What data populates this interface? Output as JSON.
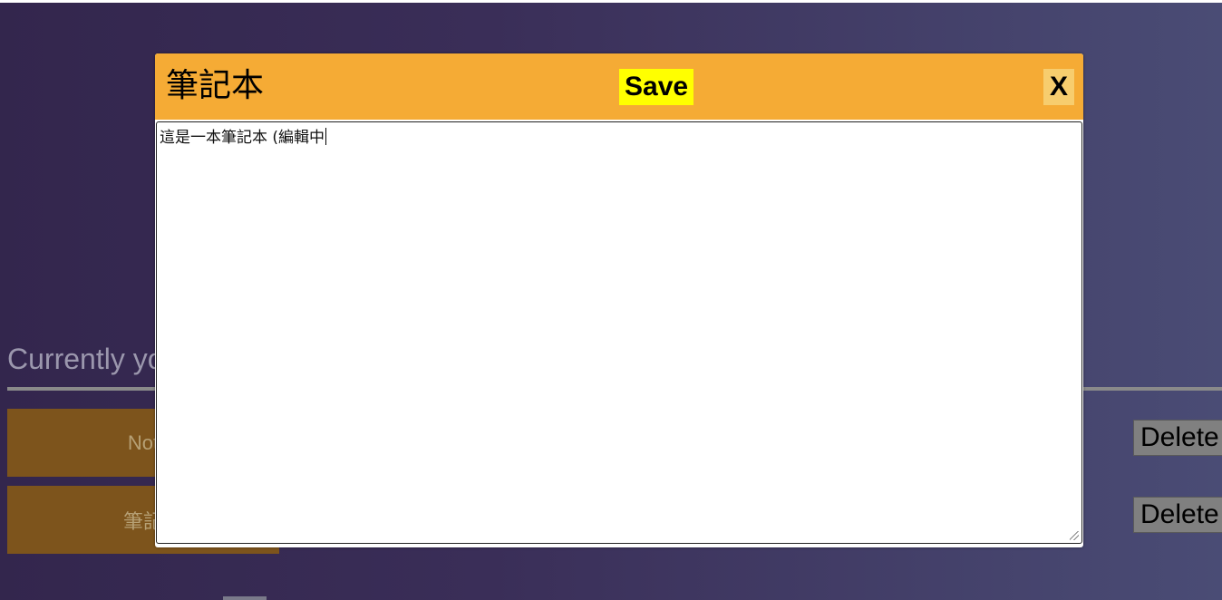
{
  "background": {
    "heading": "Currently yo",
    "notes": [
      {
        "label": "Not"
      },
      {
        "label": "筆記"
      }
    ],
    "delete_label": "Delete"
  },
  "modal": {
    "title": "筆記本",
    "save_label": "Save",
    "close_label": "X",
    "content": "這是一本筆記本 (編輯中"
  },
  "colors": {
    "header": "#f5ab35",
    "save_button": "#ffff00",
    "note_card": "#7d541c"
  }
}
